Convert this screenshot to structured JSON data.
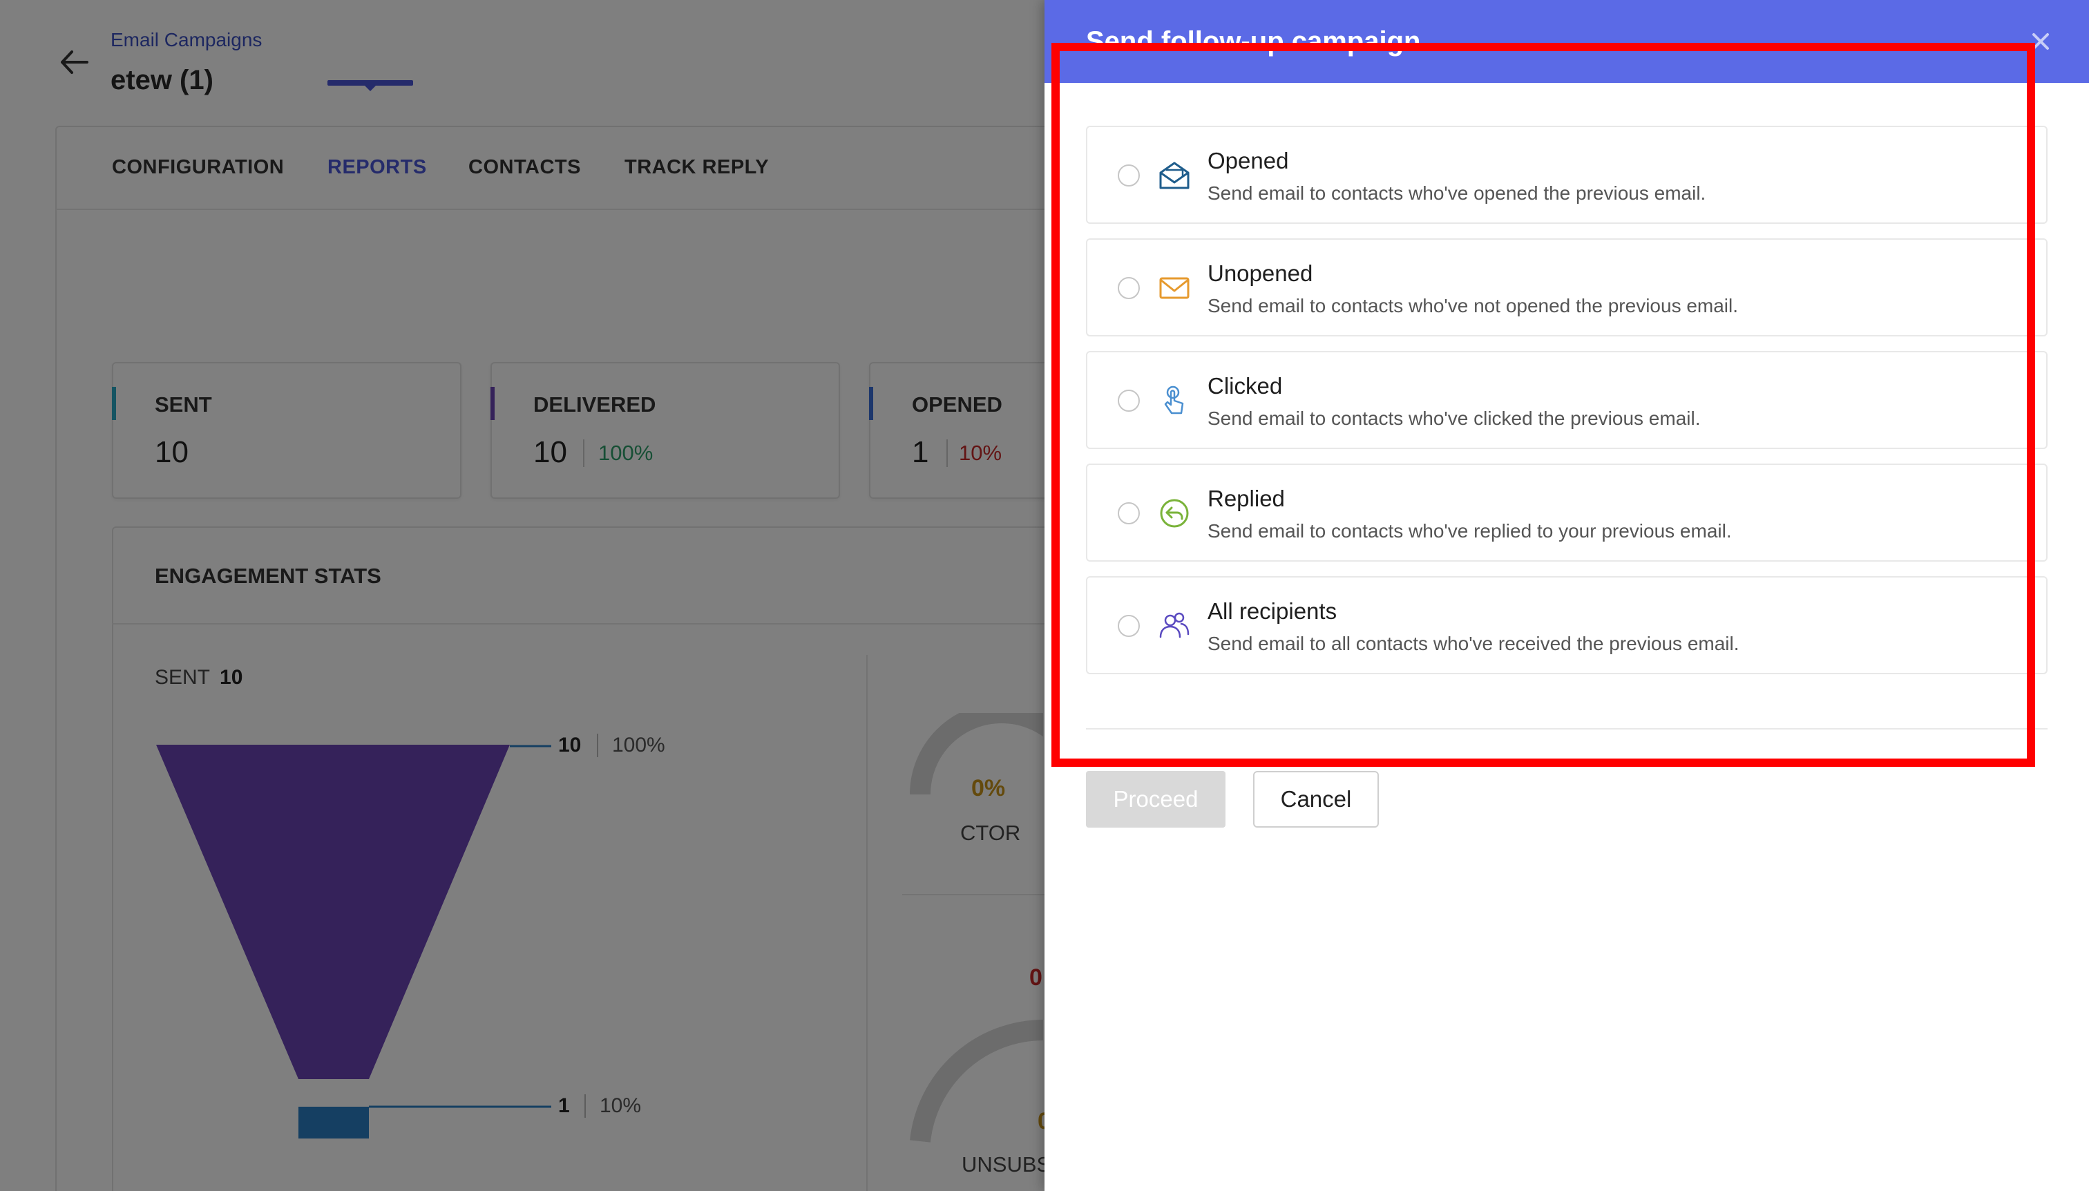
{
  "header": {
    "breadcrumb": "Email Campaigns",
    "title": "etew (1)"
  },
  "tabs": [
    {
      "label": "CONFIGURATION"
    },
    {
      "label": "REPORTS"
    },
    {
      "label": "CONTACTS"
    },
    {
      "label": "TRACK REPLY"
    }
  ],
  "active_tab": "REPORTS",
  "stats": [
    {
      "label": "SENT",
      "value": "10",
      "percent": "",
      "bar_color": "#2aa8c4"
    },
    {
      "label": "DELIVERED",
      "value": "10",
      "percent": "100%",
      "percent_color": "#2e9e6a",
      "bar_color": "#6a45b5"
    },
    {
      "label": "OPENED",
      "value": "1",
      "percent": "10%",
      "percent_color": "#c62828",
      "bar_color": "#3a6fd8"
    }
  ],
  "engagement": {
    "title": "ENGAGEMENT STATS",
    "sent_label": "SENT",
    "sent_value": "10",
    "funnel": [
      {
        "value": "10",
        "percent": "100%",
        "color": "#6a45b5"
      },
      {
        "value": "1",
        "percent": "10%",
        "color": "#2a7fc4"
      }
    ],
    "ctor": {
      "percent": "0%",
      "label": "CTOR"
    },
    "unsub": {
      "percent_top": "0",
      "percent_mid": "0",
      "label": "UNSUBS"
    }
  },
  "drawer": {
    "title": "Send follow-up campaign",
    "close_glyph": "×",
    "options": [
      {
        "title": "Opened",
        "description": "Send email to contacts who've opened the previous email.",
        "icon": "envelope-open-icon",
        "icon_color": "#1f5d8c"
      },
      {
        "title": "Unopened",
        "description": "Send email to contacts who've not opened the previous email.",
        "icon": "envelope-icon",
        "icon_color": "#e69a2e"
      },
      {
        "title": "Clicked",
        "description": "Send email to contacts who've clicked the previous email.",
        "icon": "pointer-click-icon",
        "icon_color": "#4a8fd0"
      },
      {
        "title": "Replied",
        "description": "Send email to contacts who've replied to your previous email.",
        "icon": "reply-icon",
        "icon_color": "#7ab33a"
      },
      {
        "title": "All recipients",
        "description": "Send email to all contacts who've received the previous email.",
        "icon": "users-icon",
        "icon_color": "#5a4ac0"
      }
    ],
    "proceed_label": "Proceed",
    "cancel_label": "Cancel"
  }
}
